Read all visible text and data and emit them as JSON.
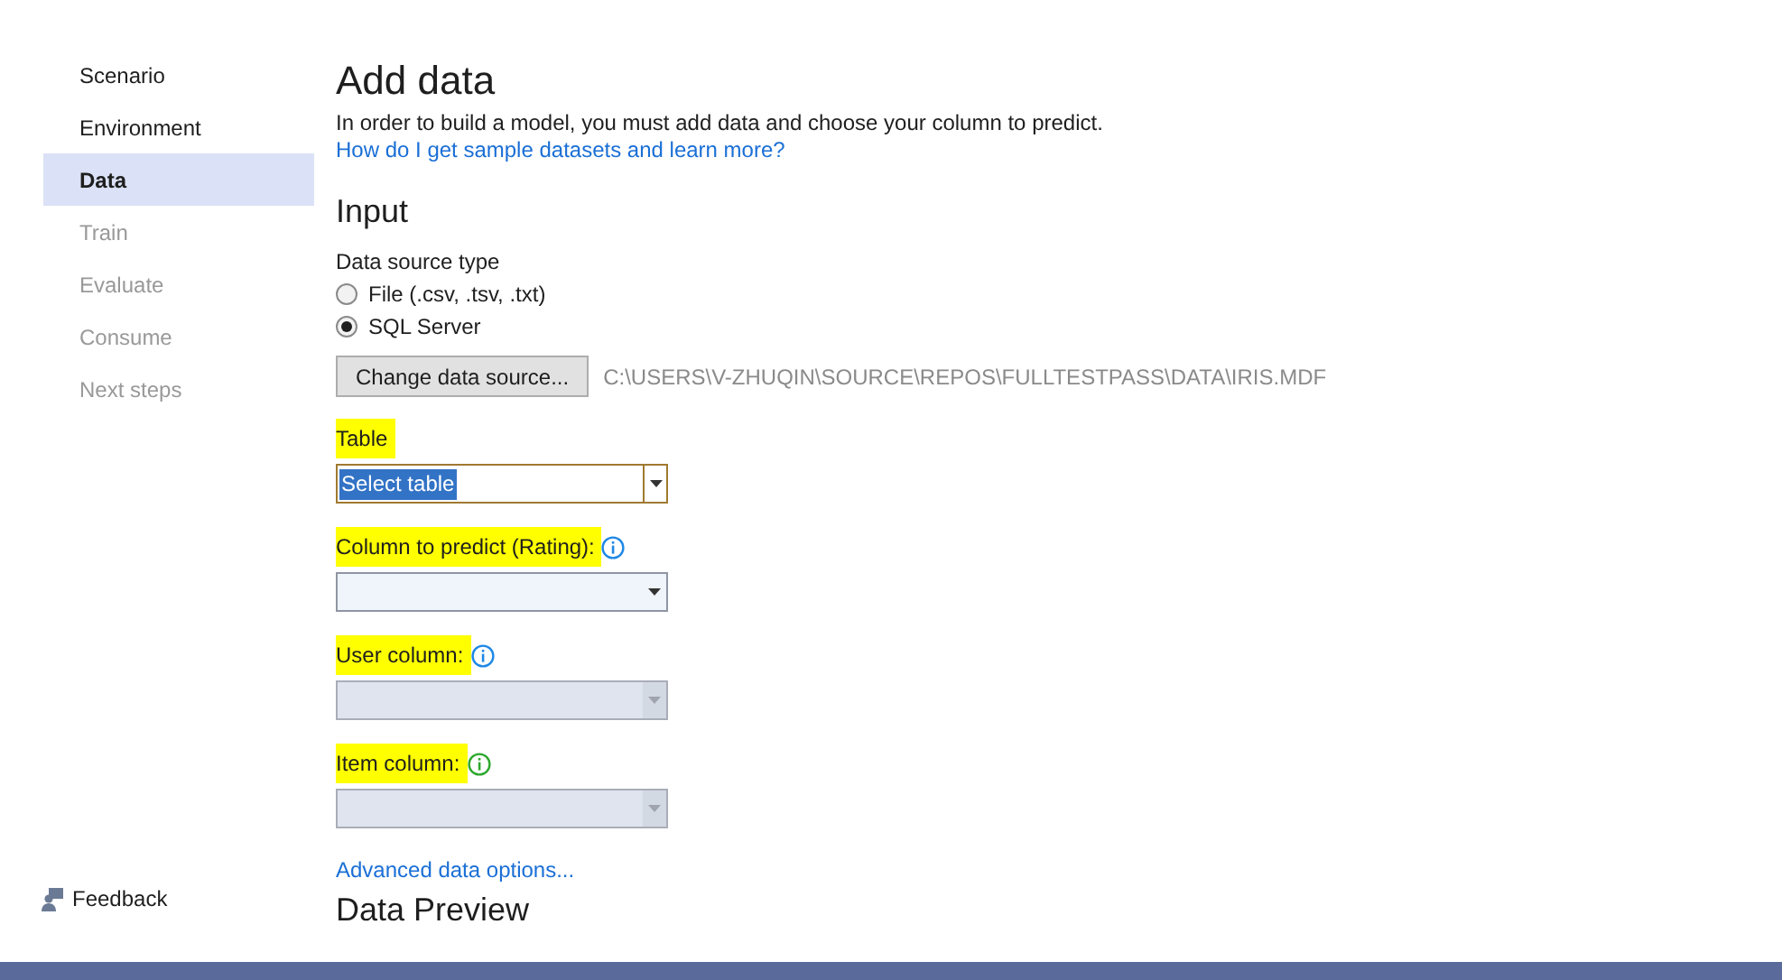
{
  "sidebar": {
    "items": [
      {
        "label": "Scenario",
        "selected": false,
        "disabled": false
      },
      {
        "label": "Environment",
        "selected": false,
        "disabled": false
      },
      {
        "label": "Data",
        "selected": true,
        "disabled": false
      },
      {
        "label": "Train",
        "selected": false,
        "disabled": true
      },
      {
        "label": "Evaluate",
        "selected": false,
        "disabled": true
      },
      {
        "label": "Consume",
        "selected": false,
        "disabled": true
      },
      {
        "label": "Next steps",
        "selected": false,
        "disabled": true
      }
    ],
    "feedback": "Feedback"
  },
  "main": {
    "title": "Add data",
    "description": "In order to build a model, you must add data and choose your column to predict.",
    "help_link": "How do I get sample datasets and learn more?",
    "input": {
      "heading": "Input",
      "source_type_label": "Data source type",
      "options": [
        {
          "label": "File (.csv, .tsv, .txt)",
          "selected": false
        },
        {
          "label": "SQL Server",
          "selected": true
        }
      ],
      "change_button": "Change data source...",
      "path": "C:\\USERS\\V-ZHUQIN\\SOURCE\\REPOS\\FULLTESTPASS\\DATA\\IRIS.MDF",
      "fields": [
        {
          "label": "Table",
          "highlighted": true,
          "value": "Select table",
          "focused": true,
          "disabled": false
        },
        {
          "label": "Column to predict (Rating):",
          "highlighted": true,
          "color": "#1e88e5",
          "focused": false,
          "disabled": false
        },
        {
          "label": "User column:",
          "highlighted": true,
          "color": "#1e88e5",
          "focused": false,
          "disabled": true
        },
        {
          "label": "Item column:",
          "highlighted": true,
          "color": "#2ea82e",
          "focused": false,
          "disabled": true
        }
      ],
      "advanced_link": "Advanced data options..."
    },
    "next_heading": "Data Preview"
  }
}
